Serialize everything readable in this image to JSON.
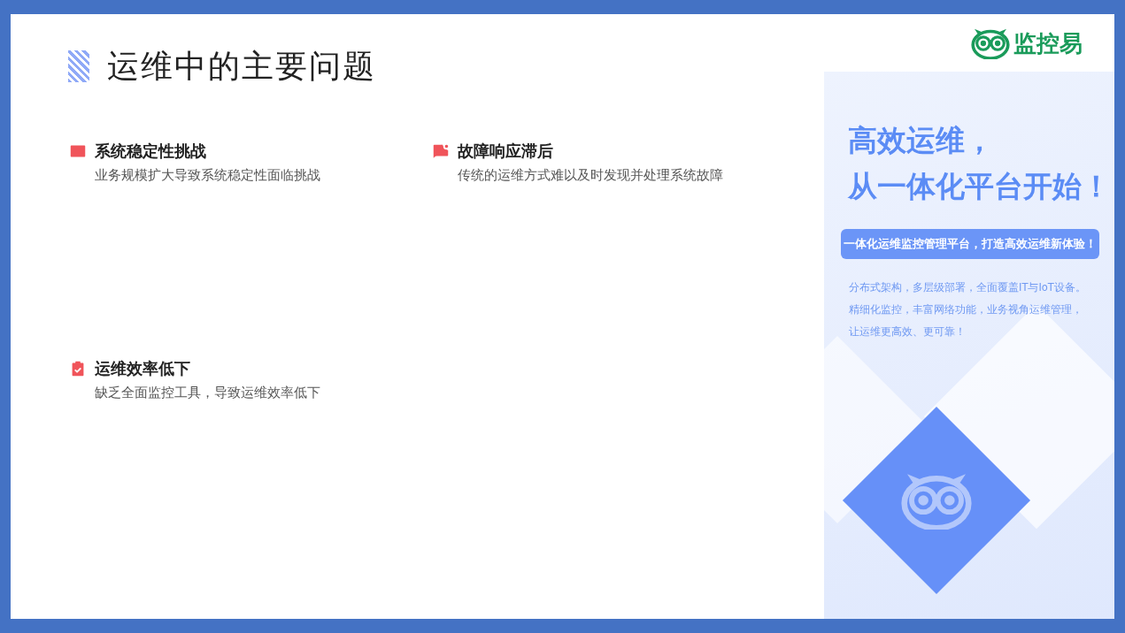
{
  "slide": {
    "title": "运维中的主要问题",
    "issues": [
      {
        "heading": "系统稳定性挑战",
        "description": "业务规模扩大导致系统稳定性面临挑战"
      },
      {
        "heading": "故障响应滞后",
        "description": "传统的运维方式难以及时发现并处理系统故障"
      },
      {
        "heading": "运维效率低下",
        "description": "缺乏全面监控工具，导致运维效率低下"
      }
    ],
    "logo_text": "监控易",
    "promo": {
      "headline": [
        "高效运维，",
        "从一体化平台开始！"
      ],
      "banner": "一体化运维监控管理平台，打造高效运维新体验！",
      "lines": [
        "分布式架构，多层级部署，全面覆盖IT与IoT设备。",
        "精细化监控，丰富网络功能，业务视角运维管理，",
        "让运维更高效、更可靠！"
      ]
    }
  }
}
